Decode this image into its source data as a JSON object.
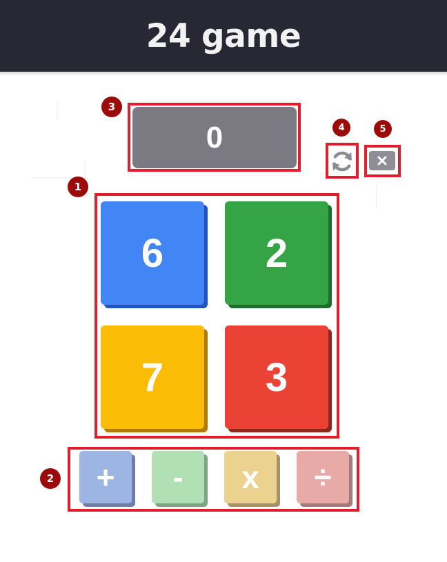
{
  "header": {
    "title": "24 game"
  },
  "result": {
    "value": "0"
  },
  "number_tiles": [
    {
      "value": "6",
      "color": "#4285f4",
      "shadow": "#1e55c0"
    },
    {
      "value": "2",
      "color": "#34a446",
      "shadow": "#1e6e2c"
    },
    {
      "value": "7",
      "color": "#fbbc05",
      "shadow": "#b07c05"
    },
    {
      "value": "3",
      "color": "#ea4335",
      "shadow": "#8c2a22"
    }
  ],
  "operators": [
    {
      "symbol": "+",
      "color": "#9db5e3",
      "shadow": "#6c7fa6"
    },
    {
      "symbol": "-",
      "color": "#b0e0b3",
      "shadow": "#7ea482"
    },
    {
      "symbol": "x",
      "color": "#ebd28f",
      "shadow": "#a6916a"
    },
    {
      "symbol": "÷",
      "color": "#e8aaa7",
      "shadow": "#a57a77"
    }
  ],
  "controls": {
    "refresh_icon": "refresh-icon",
    "close_icon": "close-icon"
  },
  "annotations": {
    "badge_1": "1",
    "badge_2": "2",
    "badge_3": "3",
    "badge_4": "4",
    "badge_5": "5",
    "frame_color": "#e11d2e",
    "badge_color": "#9c0a0a"
  }
}
